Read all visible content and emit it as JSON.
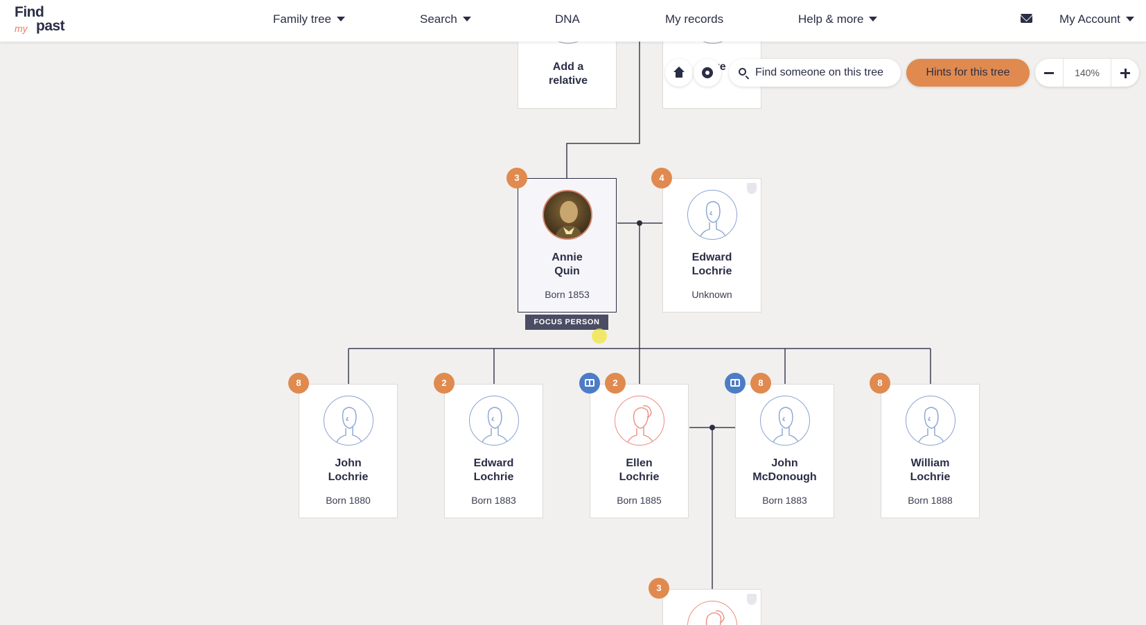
{
  "brand": {
    "line1": "Find",
    "line2": "my",
    "line3": "past"
  },
  "nav": {
    "family_tree": "Family tree",
    "search": "Search",
    "dna": "DNA",
    "my_records": "My records",
    "help_more": "Help & more",
    "my_account": "My Account"
  },
  "toolbar": {
    "search_placeholder": "Find someone on this tree",
    "hints_label": "Hints for this tree",
    "zoom_level": "140%"
  },
  "tree": {
    "top_left_card": "Add a relative",
    "top_right_card_partial": "a ive",
    "focus_label": "FOCUS PERSON",
    "focus": {
      "name": "Annie Quin",
      "sub": "Born 1853",
      "hints": "3"
    },
    "spouse": {
      "name": "Edward Lochrie",
      "sub": "Unknown",
      "hints": "4"
    },
    "children": [
      {
        "name": "John Lochrie",
        "sub": "Born 1880",
        "hints": "8"
      },
      {
        "name": "Edward Lochrie",
        "sub": "Born 1883",
        "hints": "2"
      },
      {
        "name": "Ellen Lochrie",
        "sub": "Born 1885",
        "hints": "2"
      },
      {
        "name": "John McDonough",
        "sub": "Born 1883",
        "hints": "8"
      },
      {
        "name": "William Lochrie",
        "sub": "Born 1888",
        "hints": "8"
      }
    ],
    "grandchild": {
      "hints": "3"
    }
  },
  "colors": {
    "accent": "#e08a4f",
    "ink": "#2a2d45",
    "record_badge": "#4d7cc7",
    "female": "#ee8b7f",
    "male": "#8aa3cf"
  }
}
